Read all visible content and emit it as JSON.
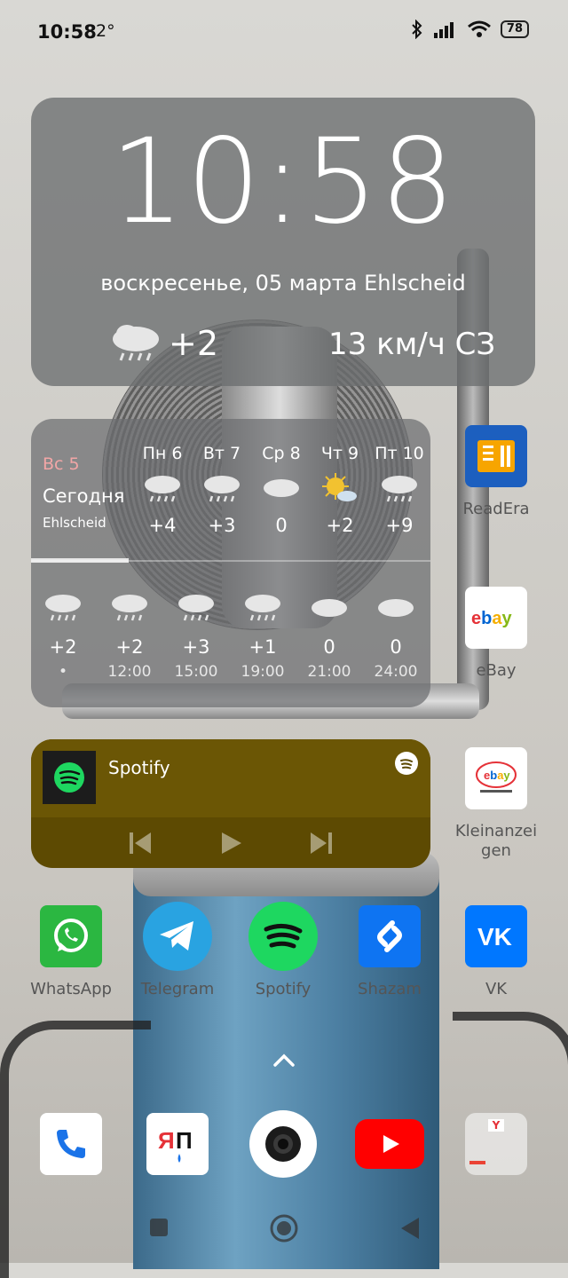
{
  "status_bar": {
    "time": "10:58",
    "temp": "2°",
    "battery": "78"
  },
  "clock_widget": {
    "time": "10:58",
    "date": "воскресенье, 05 марта Ehlscheid",
    "temperature": "+2",
    "wind": "13 км/ч СЗ"
  },
  "weather_widget": {
    "today": {
      "day": "Вс 5",
      "label": "Сегодня",
      "city": "Ehlscheid"
    },
    "days": [
      {
        "label": "Пн 6",
        "icon": "rain-cloud-icon",
        "temp": "+4"
      },
      {
        "label": "Вт 7",
        "icon": "rain-cloud-icon",
        "temp": "+3"
      },
      {
        "label": "Ср 8",
        "icon": "cloud-icon",
        "temp": "0"
      },
      {
        "label": "Чт 9",
        "icon": "sun-cloud-icon",
        "temp": "+2"
      },
      {
        "label": "Пт 10",
        "icon": "rain-cloud-icon",
        "temp": "+9"
      }
    ],
    "hours": [
      {
        "icon": "rain-cloud-icon",
        "temp": "+2",
        "time": "•"
      },
      {
        "icon": "rain-cloud-icon",
        "temp": "+2",
        "time": "12:00"
      },
      {
        "icon": "rain-cloud-icon",
        "temp": "+3",
        "time": "15:00"
      },
      {
        "icon": "rain-cloud-icon",
        "temp": "+1",
        "time": "19:00"
      },
      {
        "icon": "cloud-icon",
        "temp": "0",
        "time": "21:00"
      },
      {
        "icon": "cloud-icon",
        "temp": "0",
        "time": "24:00"
      }
    ]
  },
  "spotify_widget": {
    "title": "Spotify"
  },
  "side_apps": [
    {
      "label": "ReadEra"
    },
    {
      "label": "eBay"
    },
    {
      "label": "Kleinanzeigen"
    }
  ],
  "row_apps": [
    {
      "label": "WhatsApp"
    },
    {
      "label": "Telegram"
    },
    {
      "label": "Spotify"
    },
    {
      "label": "Shazam"
    },
    {
      "label": "VK"
    }
  ],
  "colors": {
    "whatsapp": "#2bb741",
    "telegram": "#29a3e1",
    "spotify": "#1ed760",
    "shazam": "#0e74f2",
    "vk": "#0077ff",
    "youtube": "#ff0000"
  }
}
